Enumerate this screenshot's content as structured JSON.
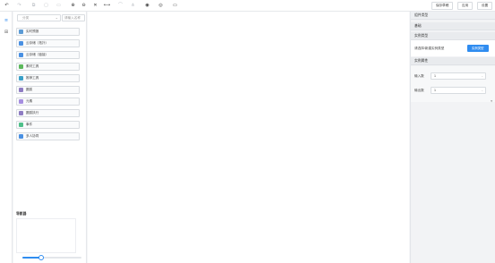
{
  "toolbar": {
    "icons": [
      {
        "name": "undo-icon",
        "glyph": "↶",
        "enabled": true
      },
      {
        "name": "redo-icon",
        "glyph": "↷",
        "enabled": false
      },
      {
        "name": "copy-icon",
        "glyph": "⧉",
        "enabled": false
      },
      {
        "name": "paste-icon",
        "glyph": "▢",
        "enabled": false
      },
      {
        "name": "delete-icon",
        "glyph": "▭",
        "enabled": false
      },
      {
        "name": "zoom-in-icon",
        "glyph": "⊕",
        "enabled": true
      },
      {
        "name": "zoom-out-icon",
        "glyph": "⊖",
        "enabled": true
      },
      {
        "name": "fit-icon",
        "glyph": "✕",
        "enabled": true
      },
      {
        "name": "actual-size-icon",
        "glyph": "⟷",
        "enabled": true
      },
      {
        "name": "align-icon",
        "glyph": "⌒",
        "enabled": false
      },
      {
        "name": "auto-layout-icon",
        "glyph": "⋔",
        "enabled": false
      },
      {
        "name": "target-icon",
        "glyph": "◉",
        "enabled": true
      },
      {
        "name": "preview-icon",
        "glyph": "◎",
        "enabled": true
      },
      {
        "name": "monitor-icon",
        "glyph": "▭",
        "enabled": true
      }
    ],
    "buttons": [
      {
        "name": "save-draft-button",
        "label": "保存草稿"
      },
      {
        "name": "apply-button",
        "label": "应用"
      },
      {
        "name": "settings-button",
        "label": "设置"
      }
    ]
  },
  "rail": {
    "items": [
      {
        "name": "component-library-icon",
        "glyph": "≡",
        "active": true
      },
      {
        "name": "layers-icon",
        "glyph": "⊞",
        "active": false
      }
    ]
  },
  "panel": {
    "search_placeholder": "分类",
    "type_placeholder": "请输入名称",
    "components": [
      {
        "label": "实时预报",
        "color": "#5b9bd5"
      },
      {
        "label": "云存储（拓扑）",
        "color": "#4a90e2"
      },
      {
        "label": "云存储（链接）",
        "color": "#4a90e2"
      },
      {
        "label": "素材工具",
        "color": "#5cb85c"
      },
      {
        "label": "推荐工具",
        "color": "#3aa0c8"
      },
      {
        "label": "圆弧",
        "color": "#8e7cc3"
      },
      {
        "label": "元素",
        "color": "#a58ee0"
      },
      {
        "label": "圆弧执行",
        "color": "#8e7cc3"
      },
      {
        "label": "事件",
        "color": "#4fbf8a"
      },
      {
        "label": "多人协同",
        "color": "#4a90e2"
      }
    ],
    "minimap_title": "导航器",
    "zoom_level": 0.32
  },
  "right_panel": {
    "sections": {
      "component_type": "组件类型",
      "basic": "基础",
      "instance_type": "实例类型",
      "instance_props": "实例属性"
    },
    "instance_hint": "请选择/新建实例类型",
    "instance_button": "实例类型",
    "fields": [
      {
        "label": "输入数",
        "value": "1"
      },
      {
        "label": "输出数",
        "value": "1"
      }
    ]
  }
}
